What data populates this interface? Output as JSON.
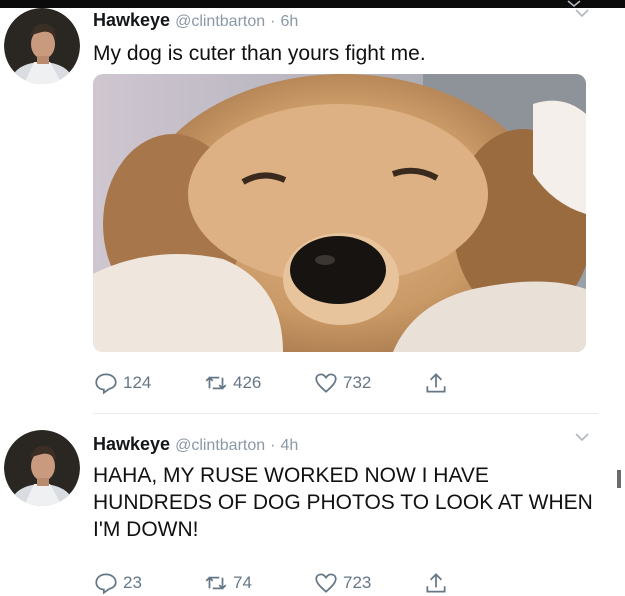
{
  "tweets": [
    {
      "name": "Hawkeye",
      "handle": "@clintbarton",
      "dot": "·",
      "time": "6h",
      "text": "My dog is cuter than yours fight me.",
      "replies": "124",
      "retweets": "426",
      "likes": "732"
    },
    {
      "name": "Hawkeye",
      "handle": "@clintbarton",
      "dot": "·",
      "time": "4h",
      "text": "HAHA, MY RUSE WORKED NOW I HAVE HUNDREDS OF DOG PHOTOS TO LOOK AT WHEN I'M DOWN!",
      "replies": "23",
      "retweets": "74",
      "likes": "723"
    }
  ],
  "icons": {
    "reply": "reply-icon",
    "retweet": "retweet-icon",
    "like": "heart-icon",
    "share": "share-icon",
    "more": "chevron-down-icon"
  },
  "colors": {
    "name": "#14171a",
    "meta": "#8b98a5",
    "actions": "#657786",
    "divider": "#e6ecf0"
  }
}
